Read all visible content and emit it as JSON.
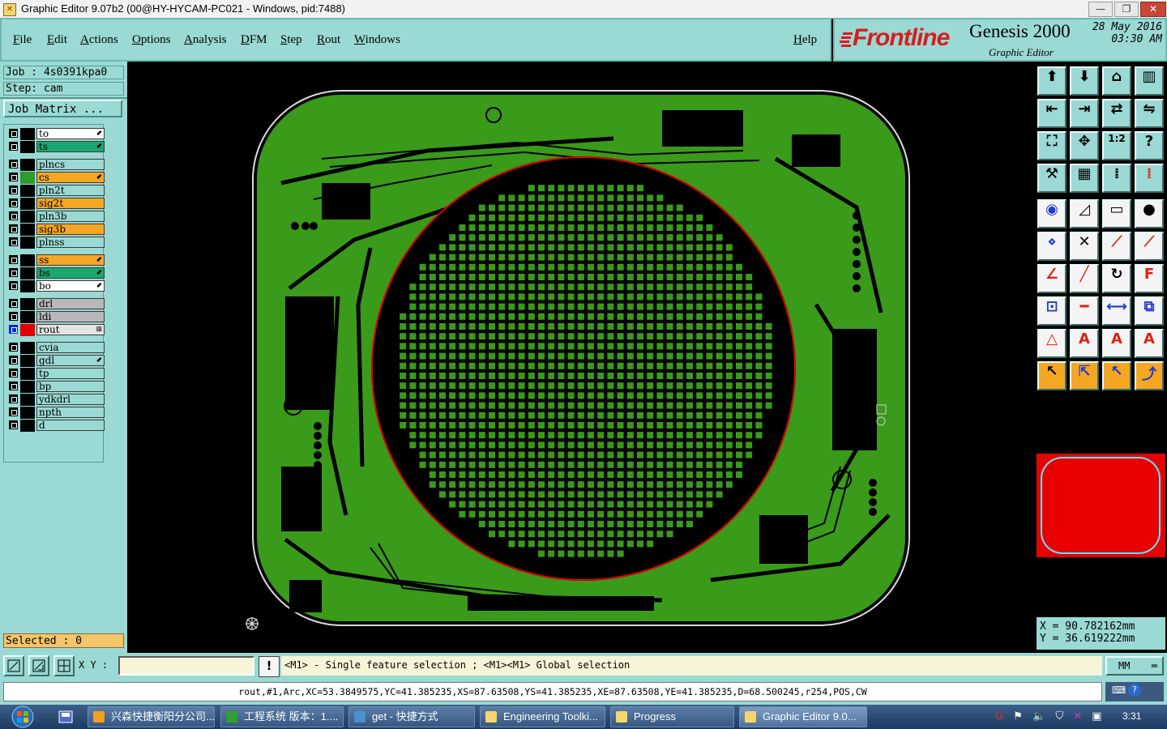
{
  "window": {
    "title": "Graphic Editor 9.07b2 (00@HY-HYCAM-PC021 - Windows, pid:7488)",
    "minimize": "—",
    "maximize": "❐",
    "close": "✕"
  },
  "menu": {
    "items": [
      "File",
      "Edit",
      "Actions",
      "Options",
      "Analysis",
      "DFM",
      "Step",
      "Rout",
      "Windows"
    ],
    "help": "Help"
  },
  "logo": {
    "brand": "Frontline",
    "product": "Genesis 2000",
    "subtitle": "Graphic Editor",
    "date": "28 May 2016",
    "time": "03:30 AM"
  },
  "job": {
    "job_line": "Job : 4s0391kpa0",
    "step_line": "Step: cam",
    "job_matrix_button": "Job Matrix ..."
  },
  "layers": [
    {
      "name": "to",
      "color": "#ffffff",
      "group": 0,
      "arrow": true
    },
    {
      "name": "ts",
      "color": "#1aa870",
      "group": 0,
      "arrow": true
    },
    {
      "name": "plncs",
      "color": "#9ad9d4",
      "group": 1,
      "arrow": false
    },
    {
      "name": "cs",
      "color": "#f5a623",
      "group": 1,
      "arrow": true,
      "active_swatch": "#2e9a2e"
    },
    {
      "name": "pln2t",
      "color": "#9ad9d4",
      "group": 1,
      "arrow": false
    },
    {
      "name": "sig2t",
      "color": "#f5a623",
      "group": 1,
      "arrow": false
    },
    {
      "name": "pln3b",
      "color": "#9ad9d4",
      "group": 1,
      "arrow": false
    },
    {
      "name": "sig3b",
      "color": "#f5a623",
      "group": 1,
      "arrow": false
    },
    {
      "name": "plnss",
      "color": "#9ad9d4",
      "group": 1,
      "arrow": false
    },
    {
      "name": "ss",
      "color": "#f5a623",
      "group": 2,
      "arrow": true
    },
    {
      "name": "bs",
      "color": "#1aa870",
      "group": 2,
      "arrow": true
    },
    {
      "name": "bo",
      "color": "#ffffff",
      "group": 2,
      "arrow": true
    },
    {
      "name": "drl",
      "color": "#b8b8b8",
      "group": 3,
      "arrow": false
    },
    {
      "name": "ldi",
      "color": "#b8b8b8",
      "group": 3,
      "arrow": false
    },
    {
      "name": "rout",
      "color": "#e4e4e4",
      "group": 3,
      "arrow": false,
      "active_swatch": "#e00000"
    },
    {
      "name": "cvia",
      "color": "#9ad9d4",
      "group": 4,
      "arrow": false
    },
    {
      "name": "gdl",
      "color": "#9ad9d4",
      "group": 4,
      "arrow": true
    },
    {
      "name": "tp",
      "color": "#9ad9d4",
      "group": 4,
      "arrow": false
    },
    {
      "name": "bp",
      "color": "#9ad9d4",
      "group": 4,
      "arrow": false
    },
    {
      "name": "ydkdrl",
      "color": "#9ad9d4",
      "group": 4,
      "arrow": false
    },
    {
      "name": "npth",
      "color": "#9ad9d4",
      "group": 4,
      "arrow": false
    },
    {
      "name": "d",
      "color": "#9ad9d4",
      "group": 4,
      "arrow": false
    }
  ],
  "selected": "Selected : 0",
  "tools": [
    "copy-up-icon",
    "copy-down-icon",
    "home-icon",
    "window-icon",
    "move-left-icon",
    "move-right-icon",
    "flip-icon",
    "swap-icon",
    "fit-icon",
    "center-icon",
    "ratio-1-2-icon",
    "help-question-icon",
    "measure-tool-icon",
    "grid-icon",
    "snap-pads-icon",
    "snap-pads-red-icon",
    "pad-add-icon",
    "polygon-icon",
    "ruler-icon",
    "circle-pad-icon",
    "node-edit-icon",
    "cross-icon",
    "line-connect-icon",
    "line-connect-red-icon",
    "angle-icon",
    "line-diagonal-icon",
    "arc-icon",
    "text-f-icon",
    "dual-pad-icon",
    "dash-icon",
    "dimension-icon",
    "multi-shape-icon",
    "triangle-icon",
    "triangle-a-icon",
    "triangle-a-bold-icon",
    "triangle-a-bar-icon",
    "select-arrow-icon",
    "select-box-icon",
    "select-circle-icon",
    "select-path-icon"
  ],
  "coords": {
    "x": "X = 90.782162mm",
    "y": "Y = 36.619222mm"
  },
  "status": {
    "xy_label": "X Y :",
    "xy_value": "",
    "warn": "!",
    "prompt": "<M1> - Single feature selection ; <M1><M1> Global selection",
    "unit": "MM",
    "info": "rout,#1,Arc,XC=53.3849575,YC=41.385235,XS=87.63508,YS=41.385235,XE=87.63508,YE=41.385235,D=68.500245,r254,POS,CW"
  },
  "taskbar": {
    "tasks": [
      {
        "label": "兴森快捷衡阳分公司...",
        "icon": "#f0a020"
      },
      {
        "label": "工程系统  版本：1....",
        "icon": "#2ea02e"
      },
      {
        "label": "get - 快捷方式",
        "icon": "#4a90d0"
      },
      {
        "label": "Engineering Toolki...",
        "icon": "#f5d76e"
      },
      {
        "label": "Progress",
        "icon": "#f5d76e"
      },
      {
        "label": "Graphic Editor 9.0...",
        "icon": "#f5d76e",
        "active": true
      }
    ],
    "clock": "3:31"
  },
  "colors": {
    "panel": "#9ad9d4",
    "board_copper": "#3a9a1a",
    "rout_outline": "#e00000",
    "canvas": "#000000"
  }
}
